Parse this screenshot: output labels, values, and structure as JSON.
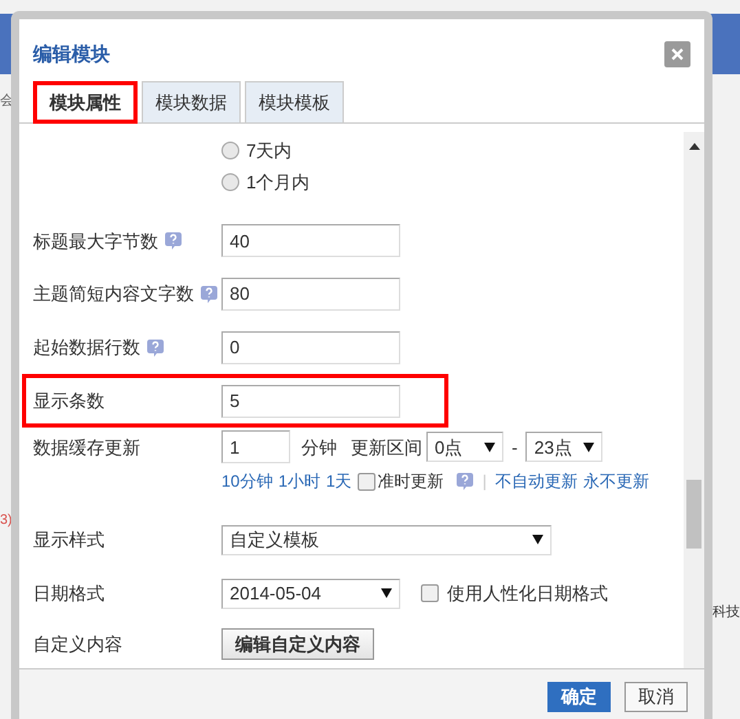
{
  "background_fragments": [
    {
      "text": "会",
      "color": "#666666"
    },
    {
      "text": "3)",
      "color": "#d9534f"
    },
    {
      "text": "科技",
      "color": "#333333"
    }
  ],
  "dialog": {
    "title": "编辑模块"
  },
  "tabs": [
    {
      "label": "模块属性",
      "selected": true,
      "highlighted": true
    },
    {
      "label": "模块数据",
      "selected": false,
      "highlighted": false
    },
    {
      "label": "模块模板",
      "selected": false,
      "highlighted": false
    }
  ],
  "radios": [
    {
      "label": "7天内",
      "selected": false
    },
    {
      "label": "1个月内",
      "selected": false
    }
  ],
  "fields": [
    {
      "kind": "text",
      "label": "标题最大字节数",
      "help": true,
      "value": "40",
      "highlighted": false
    },
    {
      "kind": "text",
      "label": "主题简短内容文字数",
      "help": true,
      "value": "80",
      "highlighted": false
    },
    {
      "kind": "text",
      "label": "起始数据行数",
      "help": true,
      "value": "0",
      "highlighted": false
    },
    {
      "kind": "text",
      "label": "显示条数",
      "help": false,
      "value": "5",
      "highlighted": true
    },
    {
      "kind": "cache",
      "label": "数据缓存更新",
      "value": "1",
      "unit": "分钟",
      "range_label": "更新区间",
      "from": "0点",
      "dash": "-",
      "to": "23点",
      "quick_links": [
        "10分钟",
        "1小时",
        "1天"
      ],
      "checkbox": {
        "label": "准时更新",
        "checked": false
      },
      "divider": "|",
      "more_links": [
        "不自动更新",
        "永不更新"
      ]
    },
    {
      "kind": "select",
      "label": "显示样式",
      "value": "自定义模板"
    },
    {
      "kind": "date",
      "label": "日期格式",
      "value": "2014-05-04",
      "checkbox": {
        "label": "使用人性化日期格式",
        "checked": false
      }
    },
    {
      "kind": "button",
      "label": "自定义内容",
      "button": "编辑自定义内容"
    }
  ],
  "footer_buttons": [
    {
      "label": "确定",
      "primary": true
    },
    {
      "label": "取消",
      "primary": false
    }
  ]
}
